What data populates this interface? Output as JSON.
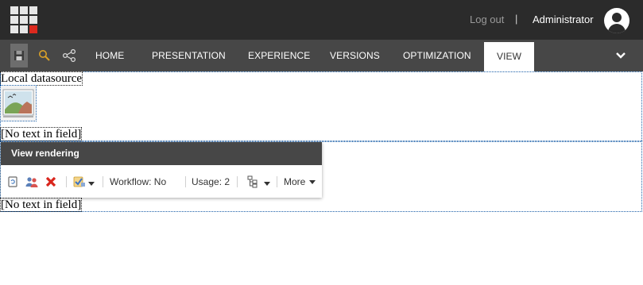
{
  "topbar": {
    "logout_label": "Log out",
    "separator": "|",
    "user_name": "Administrator",
    "grid_accent_color": "#dc291e"
  },
  "ribbon": {
    "quick_actions": [
      "save-icon",
      "search-icon",
      "navigation-tree-icon"
    ],
    "tabs": [
      {
        "label": "HOME",
        "active": false
      },
      {
        "label": "PRESENTATION",
        "active": false
      },
      {
        "label": "EXPERIENCE",
        "active": false
      },
      {
        "label": "VERSIONS",
        "active": false
      },
      {
        "label": "OPTIMIZATION",
        "active": false
      },
      {
        "label": "VIEW",
        "active": true
      }
    ]
  },
  "content": {
    "datasource_label": "Local datasource",
    "empty_field_1": "[No text in field]",
    "empty_field_2": "[No text in field]"
  },
  "chrome": {
    "title": "View rendering",
    "workflow_label": "Workflow: No",
    "usage_label": "Usage: 2",
    "more_label": "More"
  },
  "colors": {
    "topbar_bg": "#2b2b2b",
    "ribbon_bg": "#474747",
    "region_border": "#1b5fa8",
    "delete_red": "#d9251c"
  }
}
